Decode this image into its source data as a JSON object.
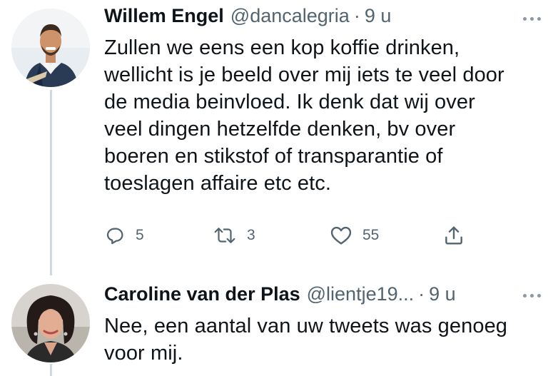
{
  "tweets": [
    {
      "author_name": "Willem Engel",
      "handle": "@dancalegria",
      "separator": "·",
      "time": "9 u",
      "text_lines": [
        "Zullen we eens een kop koffie drinken,",
        "wellicht is je beeld over mij iets te veel door",
        "de media beinvloed. Ik denk dat wij over",
        "veel dingen hetzelfde denken, bv over",
        "boeren en stikstof of transparantie of",
        "toeslagen affaire etc etc."
      ],
      "actions": {
        "replies": "5",
        "retweets": "3",
        "likes": "55"
      },
      "icons": [
        "reply-icon",
        "retweet-icon",
        "like-icon",
        "share-icon",
        "more-icon"
      ]
    },
    {
      "author_name": "Caroline van der Plas",
      "handle": "@lientje19...",
      "separator": "·",
      "time": "9 u",
      "text_lines": [
        "Nee, een aantal van uw tweets was genoeg",
        "voor mij."
      ],
      "icons": [
        "more-icon"
      ]
    }
  ],
  "colors": {
    "text": "#0f1419",
    "secondary": "#536471",
    "thread_line": "#cfd9de",
    "background": "#ffffff"
  }
}
